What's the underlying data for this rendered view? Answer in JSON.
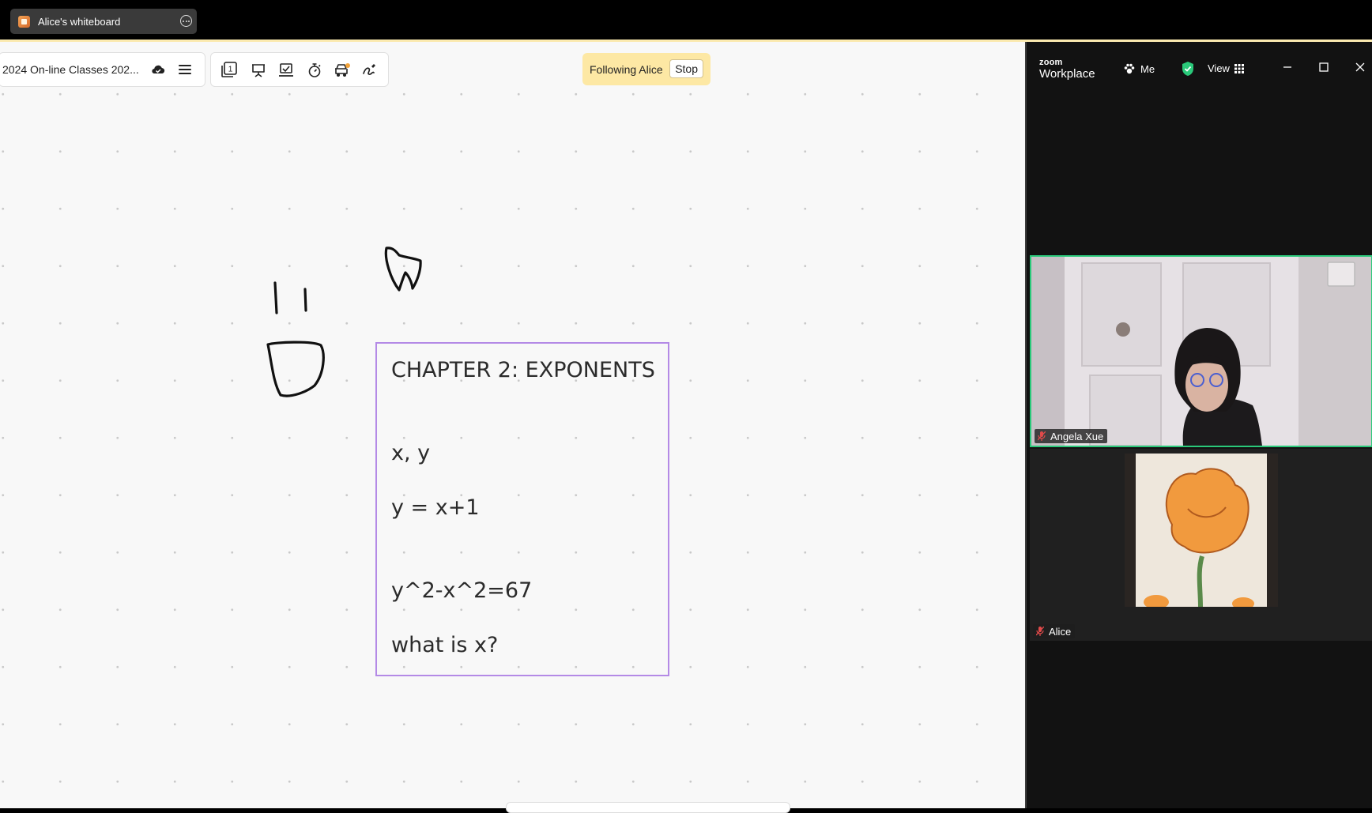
{
  "window_tab": {
    "title": "Alice's whiteboard"
  },
  "toolbar": {
    "board_title": "2024 On-line Classes 202...",
    "icons": [
      "cloud-save-icon",
      "menu-icon",
      "page-number-icon",
      "present-icon",
      "share-icon",
      "timer-icon",
      "apps-icon",
      "lasso-icon"
    ],
    "page_number": "1"
  },
  "follow_banner": {
    "text": "Following Alice",
    "stop_label": "Stop"
  },
  "whiteboard": {
    "note_lines": [
      "CHAPTER 2: EXPONENTS",
      "x, y",
      "y = x+1",
      "y^2-x^2=67",
      "what is x?"
    ],
    "border_color": "#b48ae6"
  },
  "zoom": {
    "brand_small": "zoom",
    "brand_large": "Workplace",
    "meeting_label": "Me",
    "view_label": "View",
    "security_color": "#2ac97a",
    "participants": [
      {
        "name": "Angela Xue",
        "muted": true,
        "active_speaker": true
      },
      {
        "name": "Alice",
        "muted": true,
        "active_speaker": false
      }
    ]
  }
}
